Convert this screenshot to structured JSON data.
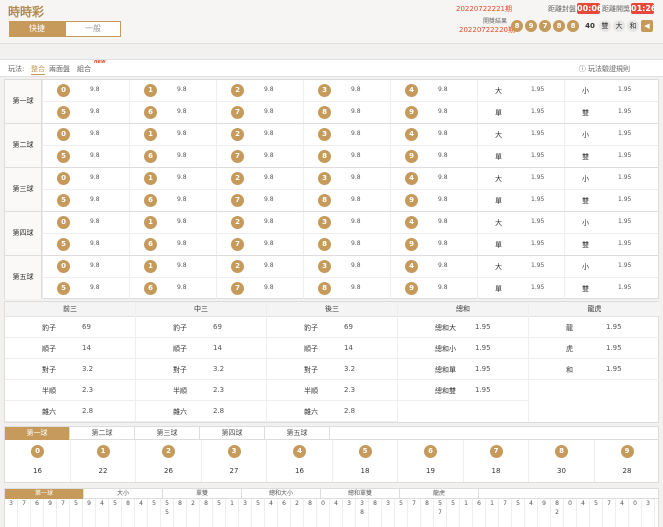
{
  "header": {
    "title": "時時彩",
    "mode_fast": "快捷",
    "mode_normal": "一般",
    "current_issue": "20220722221期",
    "close_label": "距離封盤",
    "close_time": "00:06",
    "open_label": "距離開獎",
    "open_time": "01:26",
    "prev_label": "開獎結果",
    "prev_issue": "20220722220期",
    "result_balls": [
      "8",
      "9",
      "7",
      "8",
      "8"
    ],
    "result_sum": "40",
    "result_tags": [
      "雙",
      "大",
      "和"
    ],
    "sound_icon": "speaker-icon"
  },
  "playbar": {
    "label": "玩法:",
    "tabs": [
      "整合",
      "兩面盤",
      "組合"
    ],
    "new_badge": "new",
    "rules": "玩法驗證規則"
  },
  "rows": [
    {
      "label": "第一球"
    },
    {
      "label": "第二球"
    },
    {
      "label": "第三球"
    },
    {
      "label": "第四球"
    },
    {
      "label": "第五球"
    }
  ],
  "num_odds": "9.8",
  "two_side": {
    "big": "大",
    "small": "小",
    "odd": "單",
    "even": "雙",
    "odds": "1.95"
  },
  "combos": [
    {
      "header": "前三",
      "items": [
        [
          "豹子",
          "69"
        ],
        [
          "順子",
          "14"
        ],
        [
          "對子",
          "3.2"
        ],
        [
          "半順",
          "2.3"
        ],
        [
          "雜六",
          "2.8"
        ]
      ]
    },
    {
      "header": "中三",
      "items": [
        [
          "豹子",
          "69"
        ],
        [
          "順子",
          "14"
        ],
        [
          "對子",
          "3.2"
        ],
        [
          "半順",
          "2.3"
        ],
        [
          "雜六",
          "2.8"
        ]
      ]
    },
    {
      "header": "後三",
      "items": [
        [
          "豹子",
          "69"
        ],
        [
          "順子",
          "14"
        ],
        [
          "對子",
          "3.2"
        ],
        [
          "半順",
          "2.3"
        ],
        [
          "雜六",
          "2.8"
        ]
      ]
    },
    {
      "header": "總和",
      "items": [
        [
          "總和大",
          "1.95"
        ],
        [
          "總和小",
          "1.95"
        ],
        [
          "總和單",
          "1.95"
        ],
        [
          "總和雙",
          "1.95"
        ]
      ]
    },
    {
      "header": "龍虎",
      "items": [
        [
          "龍",
          "1.95"
        ],
        [
          "虎",
          "1.95"
        ],
        [
          "和",
          "1.95"
        ]
      ]
    }
  ],
  "ball_tabs": [
    "第一球",
    "第二球",
    "第三球",
    "第四球",
    "第五球"
  ],
  "stats": [
    {
      "ball": "0",
      "count": "16"
    },
    {
      "ball": "1",
      "count": "22"
    },
    {
      "ball": "2",
      "count": "26"
    },
    {
      "ball": "3",
      "count": "27"
    },
    {
      "ball": "4",
      "count": "16"
    },
    {
      "ball": "5",
      "count": "18"
    },
    {
      "ball": "6",
      "count": "19"
    },
    {
      "ball": "7",
      "count": "18"
    },
    {
      "ball": "8",
      "count": "30"
    },
    {
      "ball": "9",
      "count": "28"
    }
  ],
  "road_tabs": [
    "第一球",
    "大小",
    "單雙",
    "總和大小",
    "總和單雙",
    "龍虎"
  ],
  "road": [
    [
      "3"
    ],
    [
      "7"
    ],
    [
      "6"
    ],
    [
      "9"
    ],
    [
      "7"
    ],
    [
      "5"
    ],
    [
      "9"
    ],
    [
      "4"
    ],
    [
      "5"
    ],
    [
      "8"
    ],
    [
      "4"
    ],
    [
      "5"
    ],
    [
      "5",
      "5"
    ],
    [
      "8"
    ],
    [
      "2"
    ],
    [
      "8"
    ],
    [
      "5"
    ],
    [
      "1"
    ],
    [
      "3"
    ],
    [
      "5"
    ],
    [
      "4"
    ],
    [
      "6"
    ],
    [
      "2"
    ],
    [
      "8"
    ],
    [
      "0"
    ],
    [
      "4"
    ],
    [
      "3"
    ],
    [
      "3",
      "8"
    ],
    [
      "8"
    ],
    [
      "3"
    ],
    [
      "5"
    ],
    [
      "7"
    ],
    [
      "8"
    ],
    [
      "5",
      "7"
    ],
    [
      "5"
    ],
    [
      "1"
    ],
    [
      "6"
    ],
    [
      "1"
    ],
    [
      "7"
    ],
    [
      "5"
    ],
    [
      "4"
    ],
    [
      "9"
    ],
    [
      "8",
      "2"
    ],
    [
      "0"
    ],
    [
      "4"
    ],
    [
      "5"
    ],
    [
      "7"
    ],
    [
      "4"
    ],
    [
      "0"
    ],
    [
      "3"
    ],
    [
      "5"
    ],
    [
      "7"
    ],
    [
      "4",
      "2"
    ],
    [
      "3",
      "7"
    ],
    [
      "0"
    ],
    [
      "2"
    ],
    [
      "6"
    ],
    [
      "5"
    ],
    [
      "4"
    ],
    [
      "3",
      "3"
    ],
    [
      "9"
    ],
    [
      "7"
    ],
    [
      "6",
      "1"
    ],
    [
      "4"
    ],
    [
      "3"
    ],
    [
      "8"
    ],
    [
      "3"
    ],
    [
      "1"
    ],
    [
      "4"
    ],
    [
      "3"
    ],
    [
      "5"
    ],
    [
      "4"
    ],
    [
      "2"
    ],
    [
      "3"
    ],
    [
      "0"
    ],
    [
      "4"
    ],
    [
      "2"
    ],
    [
      "3"
    ],
    [
      "4"
    ],
    [
      "1"
    ],
    [
      "2"
    ],
    [
      "4"
    ],
    [
      "1"
    ],
    [
      "5"
    ],
    [
      "2"
    ],
    [
      "2"
    ],
    [
      "1"
    ],
    [
      "8"
    ],
    [
      "5"
    ],
    [
      "1"
    ],
    [
      "7"
    ],
    [
      "1"
    ],
    [
      "5"
    ],
    [
      "1"
    ],
    [
      "0"
    ],
    [
      "2"
    ],
    [
      "3"
    ],
    [
      "2"
    ],
    [
      "0"
    ],
    [
      "1"
    ],
    [
      "3"
    ]
  ],
  "colors": {
    "accent": "#c59a5a",
    "alert": "#e24b2a"
  }
}
